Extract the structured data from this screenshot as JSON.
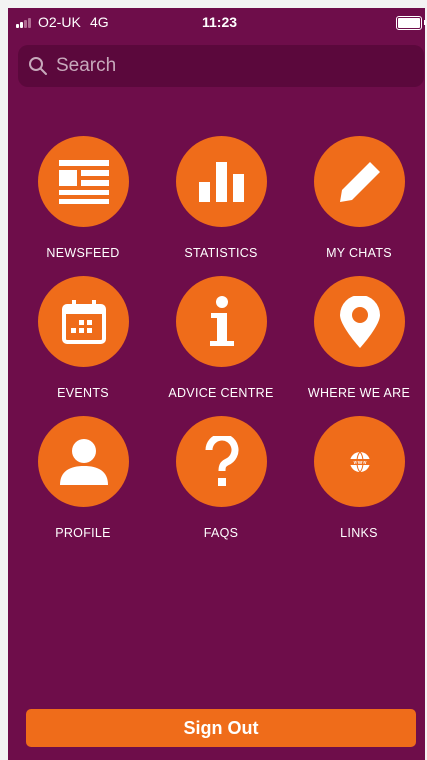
{
  "status_bar": {
    "carrier": "O2-UK",
    "network": "4G",
    "time": "11:23"
  },
  "search": {
    "placeholder": "Search"
  },
  "menu": {
    "items": [
      {
        "label": "NEWSFEED",
        "icon": "newsfeed-icon"
      },
      {
        "label": "STATISTICS",
        "icon": "bar-chart-icon"
      },
      {
        "label": "MY CHATS",
        "icon": "pencil-icon"
      },
      {
        "label": "EVENTS",
        "icon": "calendar-icon"
      },
      {
        "label": "ADVICE CENTRE",
        "icon": "info-icon"
      },
      {
        "label": "WHERE WE ARE",
        "icon": "map-pin-icon"
      },
      {
        "label": "PROFILE",
        "icon": "person-icon"
      },
      {
        "label": "FAQS",
        "icon": "question-icon"
      },
      {
        "label": "LINKS",
        "icon": "www-globe-icon"
      }
    ]
  },
  "signout": {
    "label": "Sign Out"
  },
  "colors": {
    "background": "#6e0d4a",
    "search_background": "#5b083c",
    "accent": "#ef6c1a",
    "text": "#ffffff"
  }
}
